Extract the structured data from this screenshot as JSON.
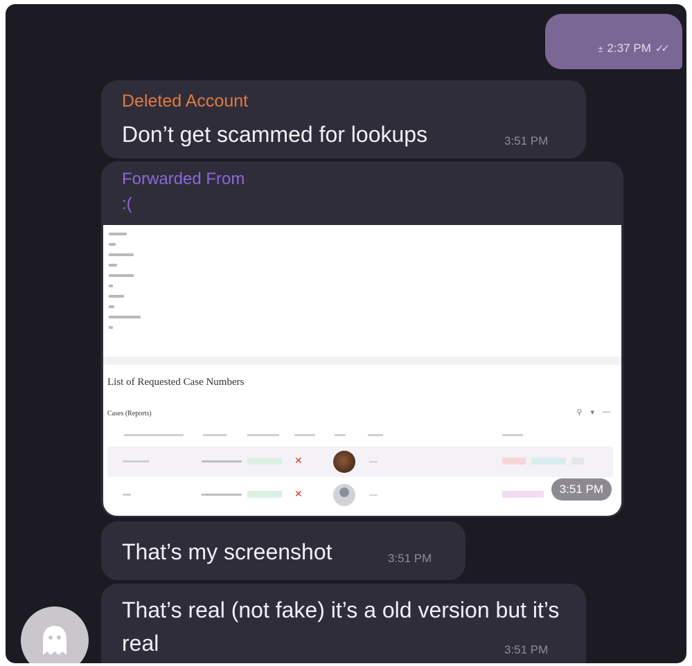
{
  "outgoing": {
    "time": "2:37 PM",
    "status_icon": "double-check-icon",
    "attachment_glyph": "±"
  },
  "messages": [
    {
      "sender": "Deleted Account",
      "text": "Don’t get scammed for lookups",
      "time": "3:51 PM"
    },
    {
      "forwarded_label": "Forwarded From",
      "forwarded_name": ":(",
      "screenshot": {
        "list_title": "List of Requested Case Numbers",
        "table_title": "Cases (Reports)",
        "tool_icons": [
          "search-icon",
          "filter-icon",
          "more-icon"
        ],
        "tool_glyphs": [
          "⚲",
          "▾",
          "—"
        ],
        "rows": [
          {
            "mark": "✕",
            "dash": "—"
          },
          {
            "mark": "✕",
            "dash": "—"
          }
        ]
      },
      "time": "3:51 PM"
    },
    {
      "text": "That’s my screenshot",
      "time": "3:51 PM"
    },
    {
      "text": "That’s real (not fake) it’s a old version but it’s real",
      "time": "3:51 PM"
    }
  ],
  "colors": {
    "background": "#1c1a22",
    "bubble": "#302d3a",
    "outgoing_bubble": "#7a6795",
    "sender_name": "#e07c3f",
    "forwarded": "#8a68d9",
    "timestamp": "#8f8a99"
  },
  "avatar": {
    "icon": "ghost-icon"
  }
}
